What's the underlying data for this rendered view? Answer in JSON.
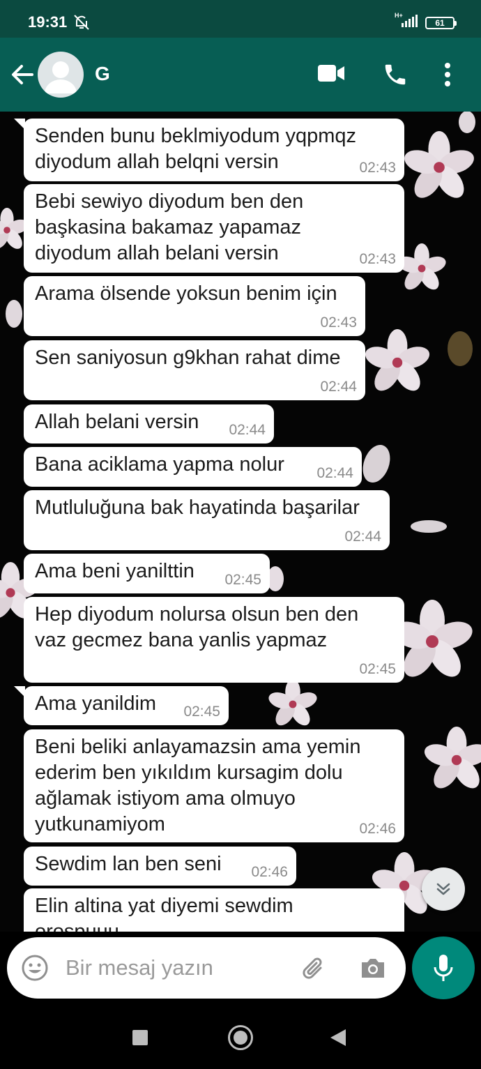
{
  "status_bar": {
    "time": "19:31",
    "network_type": "H+",
    "battery_level": "61"
  },
  "header": {
    "contact_name": "G",
    "icons": [
      "back-arrow-icon",
      "avatar-placeholder-icon",
      "video-call-icon",
      "phone-icon",
      "more-vert-icon"
    ]
  },
  "messages": [
    {
      "text": "Senden bunu beklmiyodum yqpmqz\ndiyodum allah belqni versin",
      "time": "02:43"
    },
    {
      "text": "Bebi sewiyo diyodum ben den\nbaşkasina bakamaz yapamaz\ndiyodum allah belani versin",
      "time": "02:43"
    },
    {
      "text": "Arama ölsende yoksun benim için",
      "time": "02:43"
    },
    {
      "text": "Sen saniyosun g9khan rahat dime",
      "time": "02:44"
    },
    {
      "text": "Allah belani versin",
      "time": "02:44"
    },
    {
      "text": "Bana aciklama yapma nolur",
      "time": "02:44"
    },
    {
      "text": "Mutluluğuna bak hayatinda başarilar",
      "time": "02:44"
    },
    {
      "text": "Ama beni yanilttin",
      "time": "02:45"
    },
    {
      "text": "Hep diyodum nolursa olsun ben den\nvaz gecmez bana yanlis yapmaz",
      "time": "02:45"
    },
    {
      "text": "Ama yanildim",
      "time": "02:45"
    },
    {
      "text": "Beni beliki anlayamazsin ama yemin\nederim ben yıkıldım kursagim dolu\nağlamak istiyom ama olmuyo\nyutkunamiyom",
      "time": "02:46"
    },
    {
      "text": "Sewdim lan ben seni",
      "time": "02:46"
    },
    {
      "text": "Elin altina yat diyemi sewdim\norospuuu",
      "time": ""
    }
  ],
  "composer": {
    "placeholder": "Bir mesaj yazın",
    "icons": [
      "emoji-icon",
      "attach-icon",
      "camera-icon",
      "mic-icon"
    ]
  },
  "colors": {
    "header_bg": "#075e54",
    "status_bg": "#0b4a40",
    "accent": "#00897b",
    "bubble_bg": "#ffffff",
    "chat_bg": "#050505"
  }
}
